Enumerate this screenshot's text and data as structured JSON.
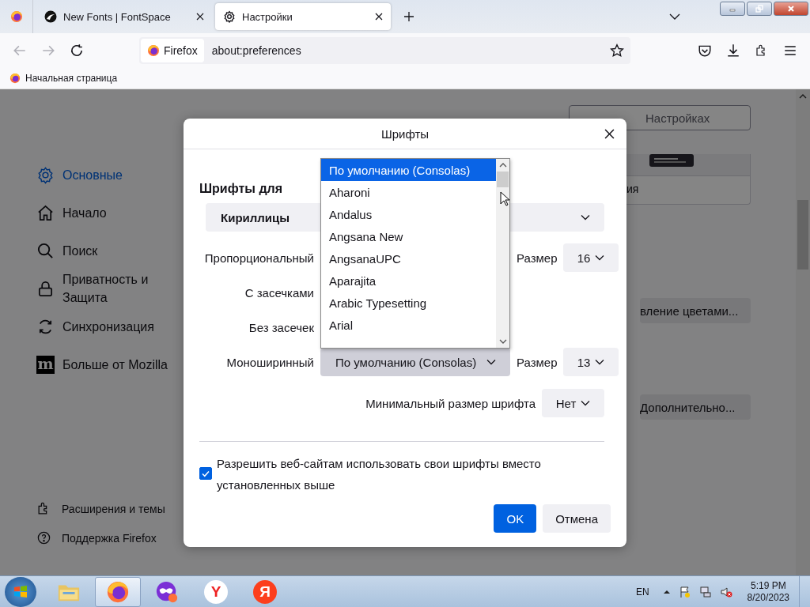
{
  "browser": {
    "tabs": [
      {
        "title": "New Fonts | FontSpace",
        "kind": "site",
        "selected": false
      },
      {
        "title": "Настройки",
        "kind": "settings",
        "selected": true
      }
    ],
    "identity": "Firefox",
    "url": "about:preferences",
    "bookmarks": [
      "Начальная страница"
    ]
  },
  "sidebar": {
    "items": [
      {
        "label": "Основные",
        "kind": "gear",
        "selected": true
      },
      {
        "label": "Начало",
        "kind": "home",
        "selected": false
      },
      {
        "label": "Поиск",
        "kind": "search",
        "selected": false
      },
      {
        "label": "Приватность и Защита",
        "kind": "lock",
        "selected": false
      },
      {
        "label": "Синхронизация",
        "kind": "sync",
        "selected": false
      },
      {
        "label": "Больше от Mozilla",
        "kind": "mozilla",
        "glyph": "m",
        "selected": false
      }
    ],
    "footer": [
      {
        "label": "Расширения и темы",
        "kind": "puzzle"
      },
      {
        "label": "Поддержка Firefox",
        "kind": "help"
      }
    ]
  },
  "page": {
    "search_placeholder": "Настройках",
    "card_text": "ия",
    "buttons": [
      "вление цветами...",
      "Дополнительно..."
    ]
  },
  "dialog": {
    "title": "Шрифты",
    "section": "Шрифты для",
    "language": "Кириллицы",
    "rows": [
      {
        "label": "Пропорциональный",
        "size_label": "Размер",
        "size": "16"
      },
      {
        "label": "С засечками"
      },
      {
        "label": "Без засечек"
      },
      {
        "label": "Моноширинный",
        "value": "По умолчанию (Consolas)",
        "pressed": true,
        "size_label": "Размер",
        "size": "13"
      }
    ],
    "min_size_label": "Минимальный размер шрифта",
    "min_size": "Нет",
    "allow": {
      "label": "Разрешить веб-сайтам использовать свои шрифты вместо установленных выше",
      "checked": true
    },
    "buttons": [
      {
        "label": "OK",
        "kind": "primary"
      },
      {
        "label": "Отмена",
        "kind": "secondary"
      }
    ]
  },
  "popup": {
    "options": [
      {
        "label": "По умолчанию (Consolas)",
        "selected": true
      },
      {
        "label": "Aharoni",
        "selected": false
      },
      {
        "label": "Andalus",
        "selected": false
      },
      {
        "label": "Angsana New",
        "selected": false
      },
      {
        "label": "AngsanaUPC",
        "selected": false
      },
      {
        "label": "Aparajita",
        "selected": false
      },
      {
        "label": "Arabic Typesetting",
        "selected": false
      },
      {
        "label": "Arial",
        "selected": false
      }
    ]
  },
  "taskbar": {
    "apps": [
      {
        "kind": "explorer",
        "selected": false
      },
      {
        "kind": "firefox",
        "selected": true
      },
      {
        "kind": "mask",
        "selected": false
      },
      {
        "kind": "yandex-browser",
        "glyph": "Y",
        "selected": false
      },
      {
        "kind": "yandex",
        "glyph": "Я",
        "selected": false
      }
    ],
    "language": "EN",
    "time": "5:19 PM",
    "date": "8/20/2023"
  }
}
